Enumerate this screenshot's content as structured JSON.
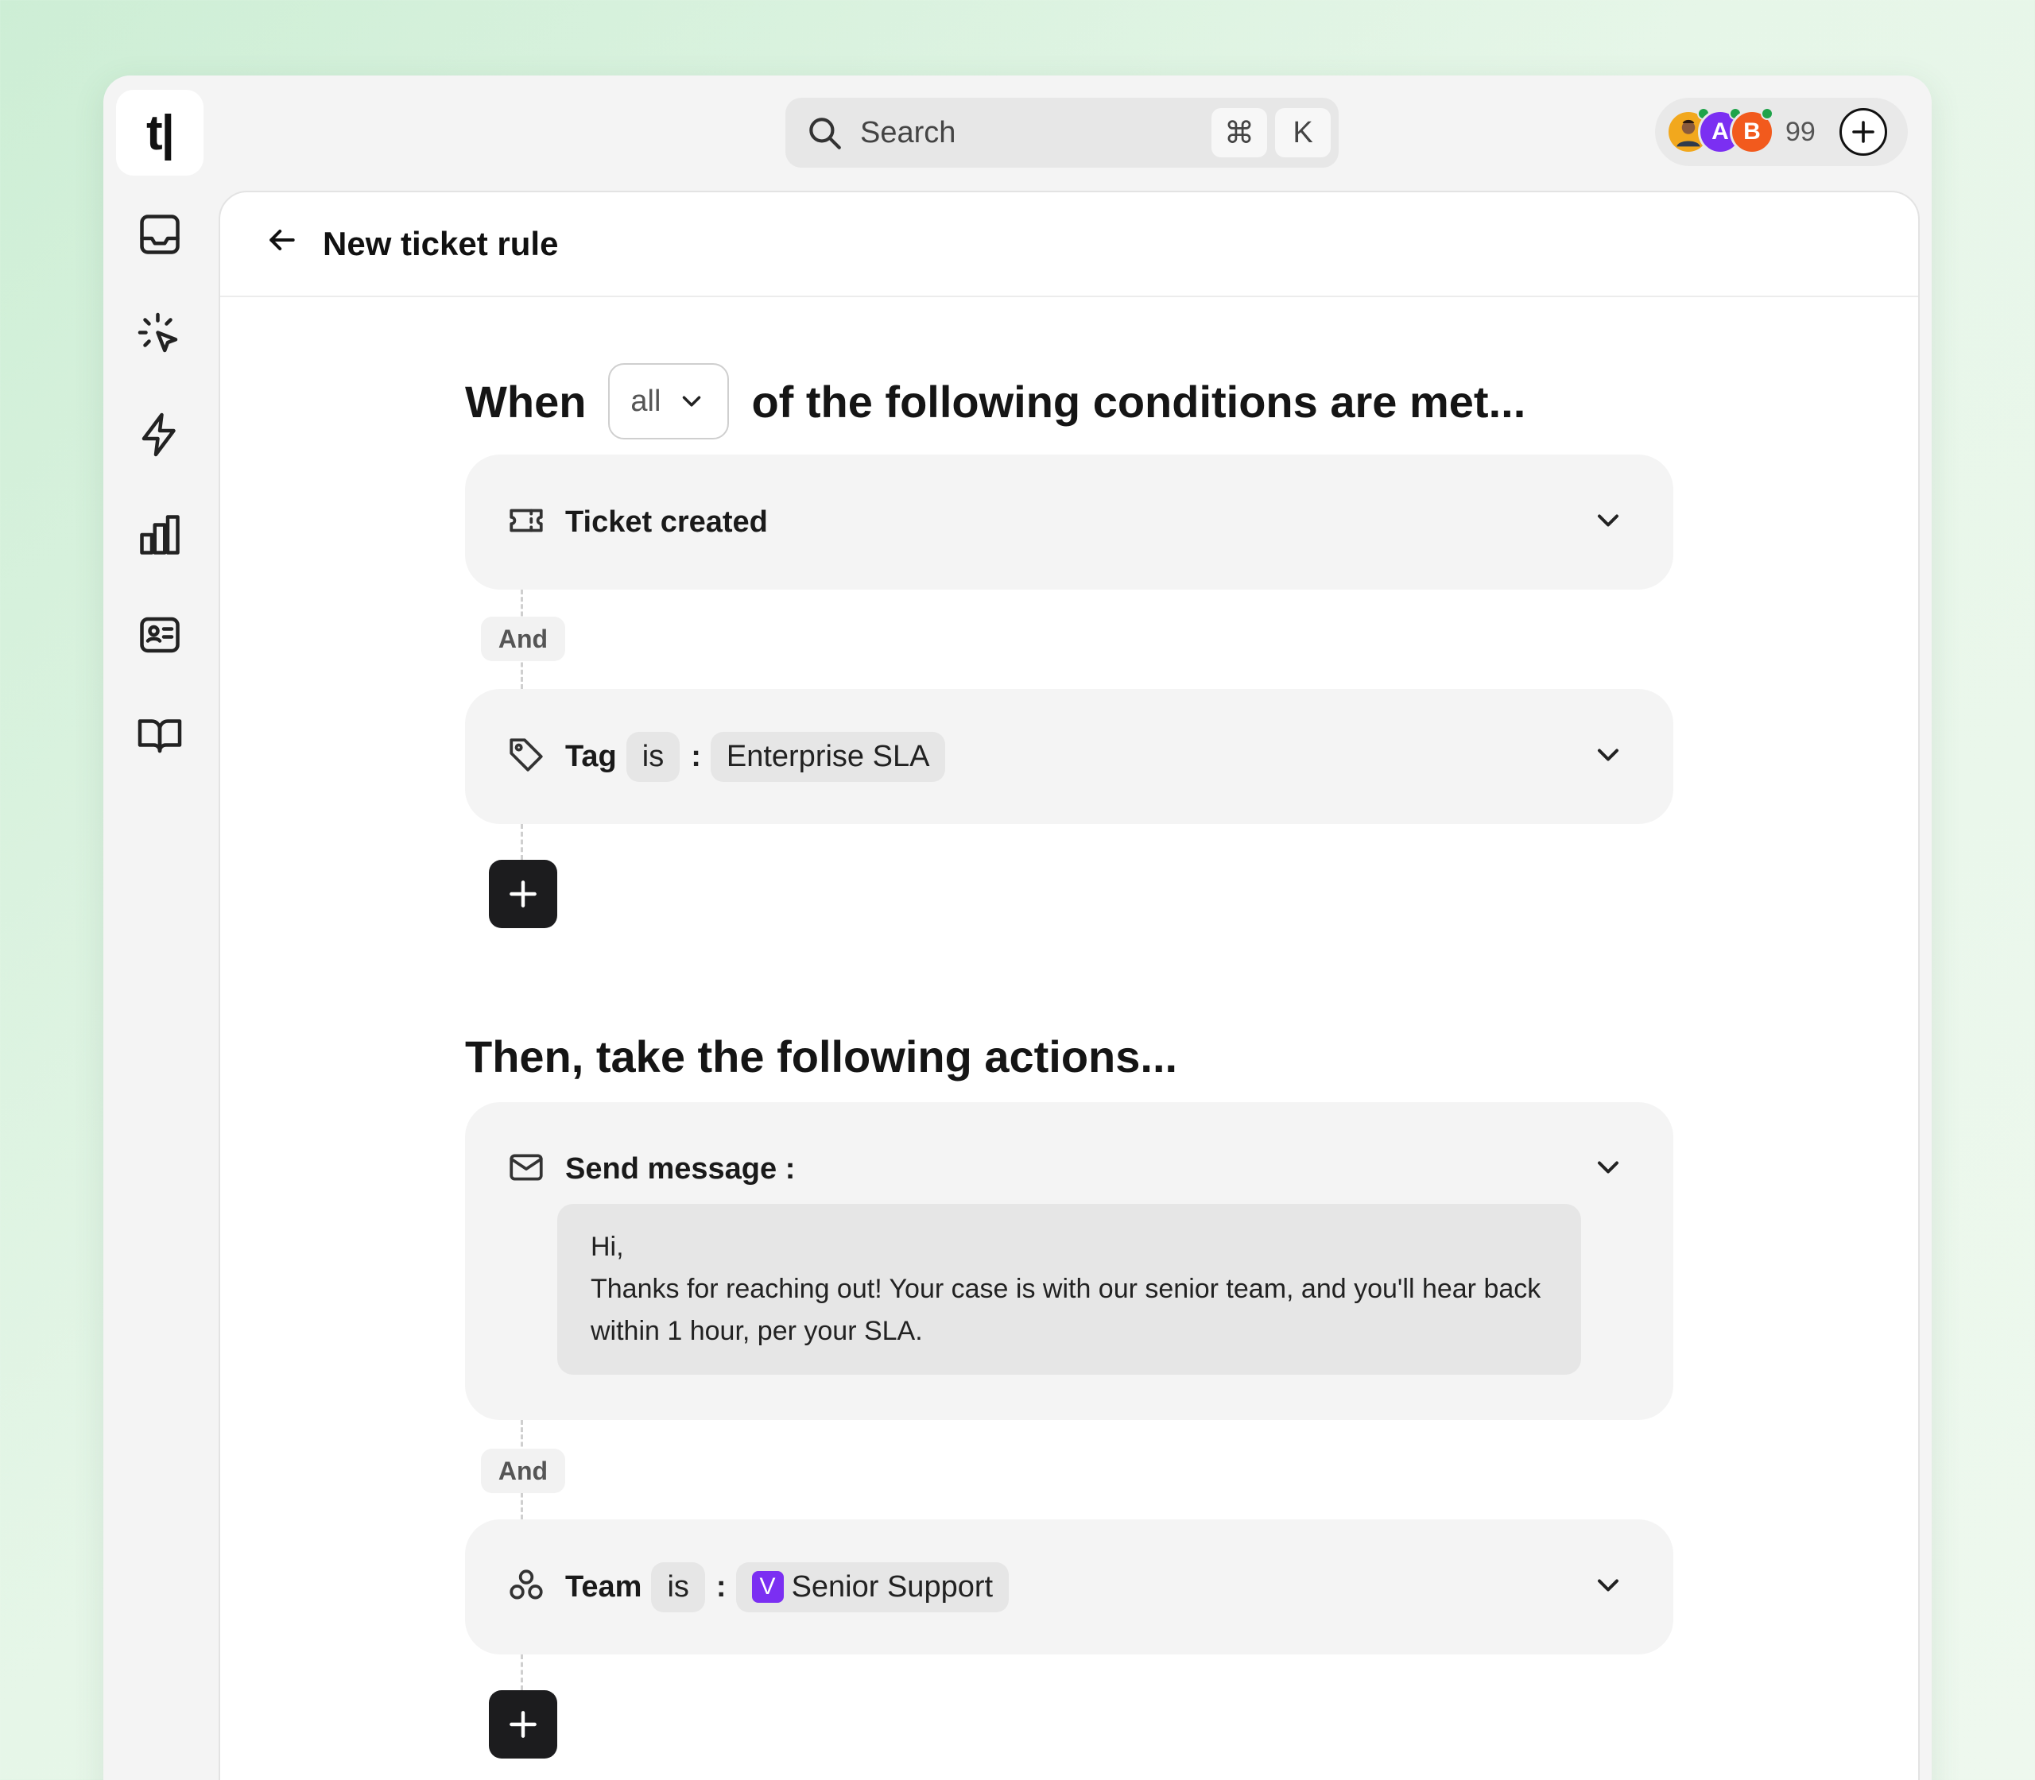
{
  "app": {
    "logo_text": "t|"
  },
  "sidebar": {
    "items": [
      {
        "icon": "inbox-icon"
      },
      {
        "icon": "sparkle-cursor-icon"
      },
      {
        "icon": "lightning-icon"
      },
      {
        "icon": "bar-chart-icon"
      },
      {
        "icon": "contact-card-icon"
      },
      {
        "icon": "book-icon"
      }
    ]
  },
  "search": {
    "placeholder": "Search",
    "shortcut_mod": "⌘",
    "shortcut_key": "K"
  },
  "presence": {
    "avatars": [
      {
        "initial": "",
        "color": "#f2a81d"
      },
      {
        "initial": "A",
        "color": "#7b2ff2"
      },
      {
        "initial": "B",
        "color": "#f25a1d"
      }
    ],
    "count": "99"
  },
  "page": {
    "title": "New ticket rule"
  },
  "conditions": {
    "heading_prefix": "When",
    "match_value": "all",
    "heading_suffix": "of the following conditions are met...",
    "items": [
      {
        "label": "Ticket created"
      },
      {
        "label": "Tag",
        "operator": "is",
        "colon": ":",
        "value": "Enterprise SLA"
      }
    ],
    "join": "And"
  },
  "actions": {
    "heading": "Then, take the following actions...",
    "send_message": {
      "label": "Send message :",
      "line1": "Hi,",
      "line2": "Thanks for reaching out! Your case is with our senior team, and you'll hear back within 1 hour, per your SLA."
    },
    "join": "And",
    "team": {
      "label": "Team",
      "operator": "is",
      "colon": ":",
      "badge": "V",
      "value": "Senior Support"
    }
  }
}
